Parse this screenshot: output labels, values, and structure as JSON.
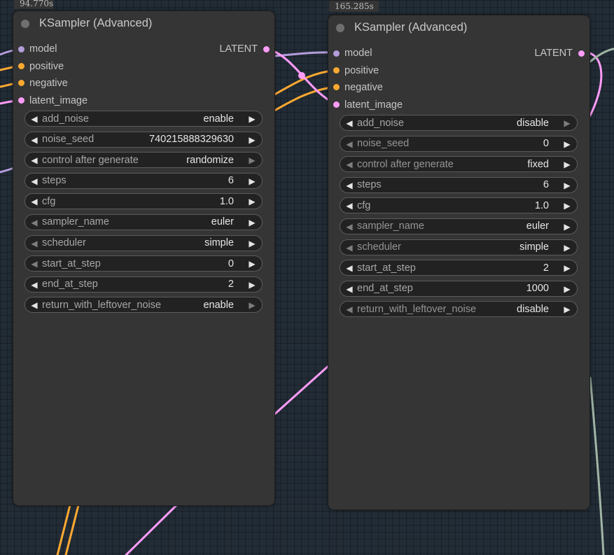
{
  "colors": {
    "canvas": "#222c36",
    "node_bg": "#353535",
    "model": "#b39ddb",
    "conditioning": "#ffa931",
    "latent": "#ff9cf9",
    "vae_wire": "#a1b5a5"
  },
  "nodes": [
    {
      "timer": "94.770s",
      "title": "KSampler (Advanced)",
      "inputs": [
        {
          "label": "model",
          "color": "#b39ddb"
        },
        {
          "label": "positive",
          "color": "#ffa931"
        },
        {
          "label": "negative",
          "color": "#ffa931"
        },
        {
          "label": "latent_image",
          "color": "#ff9cf9"
        }
      ],
      "output": {
        "label": "LATENT",
        "color": "#ff9cf9"
      },
      "widgets": [
        {
          "name": "add_noise",
          "value": "enable",
          "dim": false
        },
        {
          "name": "noise_seed",
          "value": "740215888329630",
          "dim": false
        },
        {
          "name": "control after generate",
          "value": "randomize",
          "dim": false
        },
        {
          "name": "steps",
          "value": "6",
          "dim": false
        },
        {
          "name": "cfg",
          "value": "1.0",
          "dim": false
        },
        {
          "name": "sampler_name",
          "value": "euler",
          "dim": false
        },
        {
          "name": "scheduler",
          "value": "simple",
          "dim": false
        },
        {
          "name": "start_at_step",
          "value": "0",
          "dim": false
        },
        {
          "name": "end_at_step",
          "value": "2",
          "dim": false
        },
        {
          "name": "return_with_leftover_noise",
          "value": "enable",
          "dim": false
        }
      ]
    },
    {
      "timer": "165.285s",
      "title": "KSampler (Advanced)",
      "inputs": [
        {
          "label": "model",
          "color": "#b39ddb"
        },
        {
          "label": "positive",
          "color": "#ffa931"
        },
        {
          "label": "negative",
          "color": "#ffa931"
        },
        {
          "label": "latent_image",
          "color": "#ff9cf9"
        }
      ],
      "output": {
        "label": "LATENT",
        "color": "#ff9cf9"
      },
      "widgets": [
        {
          "name": "add_noise",
          "value": "disable",
          "dim": false
        },
        {
          "name": "noise_seed",
          "value": "0",
          "dim": false
        },
        {
          "name": "control after generate",
          "value": "fixed",
          "dim": false
        },
        {
          "name": "steps",
          "value": "6",
          "dim": false
        },
        {
          "name": "cfg",
          "value": "1.0",
          "dim": false
        },
        {
          "name": "sampler_name",
          "value": "euler",
          "dim": false
        },
        {
          "name": "scheduler",
          "value": "simple",
          "dim": false
        },
        {
          "name": "start_at_step",
          "value": "2",
          "dim": false
        },
        {
          "name": "end_at_step",
          "value": "1000",
          "dim": false
        },
        {
          "name": "return_with_leftover_noise",
          "value": "disable",
          "dim": false
        }
      ]
    }
  ]
}
